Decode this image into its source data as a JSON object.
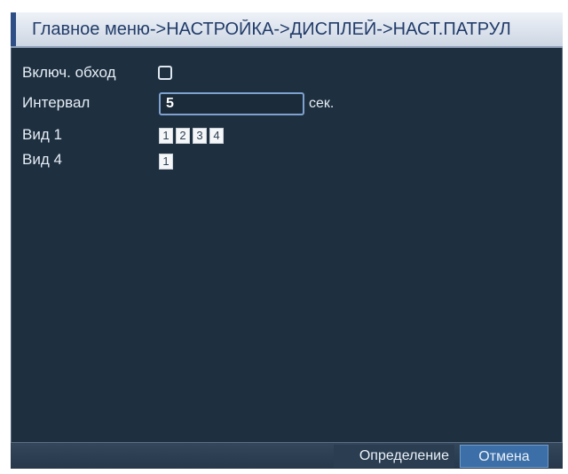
{
  "window": {
    "breadcrumb": "Главное меню->НАСТРОЙКА->ДИСПЛЕЙ->НАСТ.ПАТРУЛ"
  },
  "form": {
    "enable_label": "Включ. обход",
    "enable_checked": false,
    "interval_label": "Интервал",
    "interval_value": "5",
    "interval_unit": "сек.",
    "view1_label": "Вид 1",
    "view1_channels": [
      "1",
      "2",
      "3",
      "4"
    ],
    "view4_label": "Вид 4",
    "view4_channels": [
      "1"
    ]
  },
  "footer": {
    "ok_label": "Определение",
    "cancel_label": "Отмена"
  },
  "colors": {
    "panel_bg": "#1e2f3f",
    "title_text": "#223c6a",
    "cancel_button": "#3c6fa7"
  }
}
